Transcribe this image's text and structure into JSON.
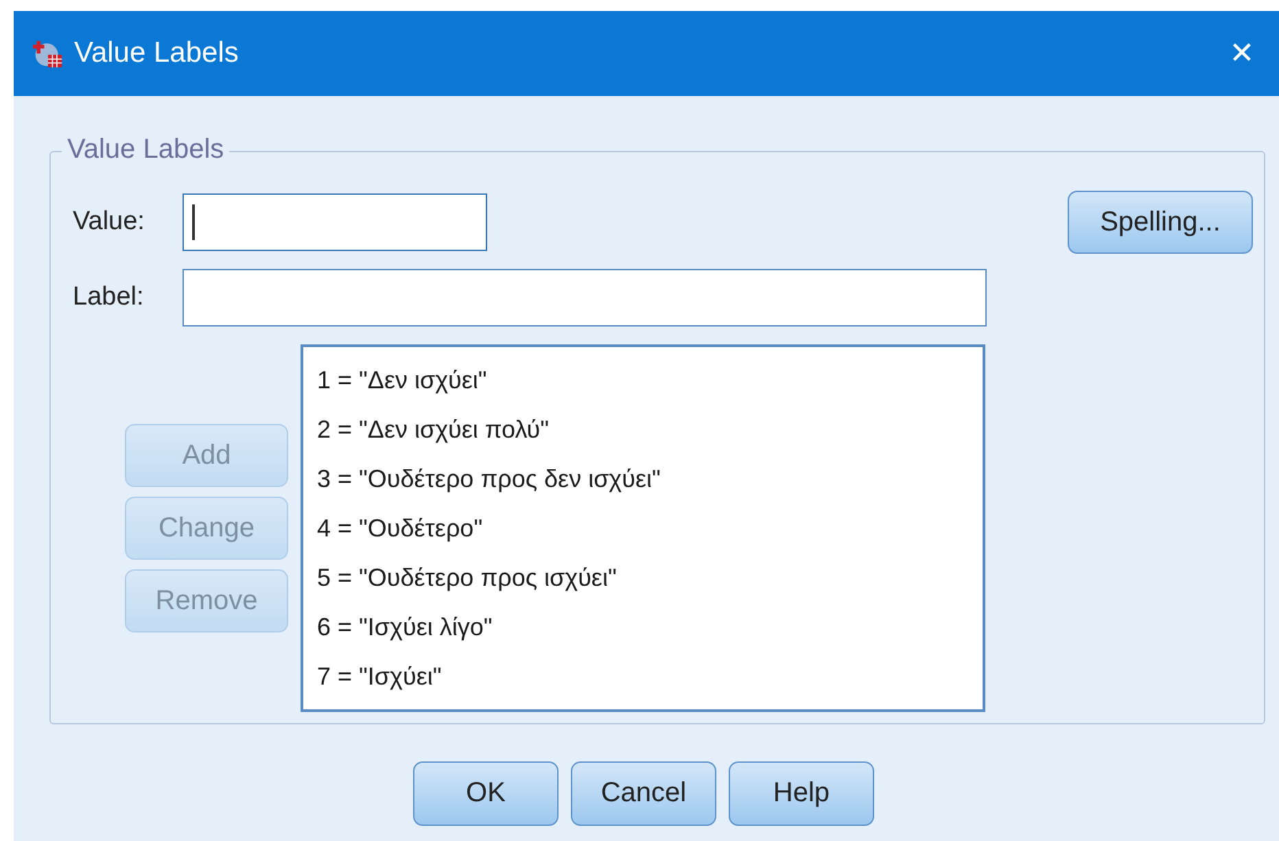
{
  "window": {
    "title": "Value Labels",
    "close": "✕"
  },
  "group": {
    "legend": "Value Labels"
  },
  "value_field": {
    "label": "Value:",
    "focused": true
  },
  "label_field": {
    "label": "Label:",
    "focused": false
  },
  "spelling_button": {
    "label": "Spelling...",
    "disabled": false
  },
  "side_buttons": [
    {
      "label": "Add",
      "disabled": true
    },
    {
      "label": "Change",
      "disabled": true
    },
    {
      "label": "Remove",
      "disabled": true
    }
  ],
  "list_items": [
    {
      "text": "1 = \"Δεν ισχύει\"",
      "selected": false
    },
    {
      "text": "2 = \"Δεν ισχύει πολύ\"",
      "selected": false
    },
    {
      "text": "3 = \"Ουδέτερο προς δεν ισχύει\"",
      "selected": false
    },
    {
      "text": "4 = \"Ουδέτερο\"",
      "selected": false
    },
    {
      "text": "5 = \"Ουδέτερο προς ισχύει\"",
      "selected": false
    },
    {
      "text": "6 = \"Ισχύει λίγο\"",
      "selected": false
    },
    {
      "text": "7 = \"Ισχύει\"",
      "selected": false
    }
  ],
  "buttons": [
    {
      "label": "OK",
      "disabled": false
    },
    {
      "label": "Cancel",
      "disabled": false
    },
    {
      "label": "Help",
      "disabled": false
    }
  ]
}
